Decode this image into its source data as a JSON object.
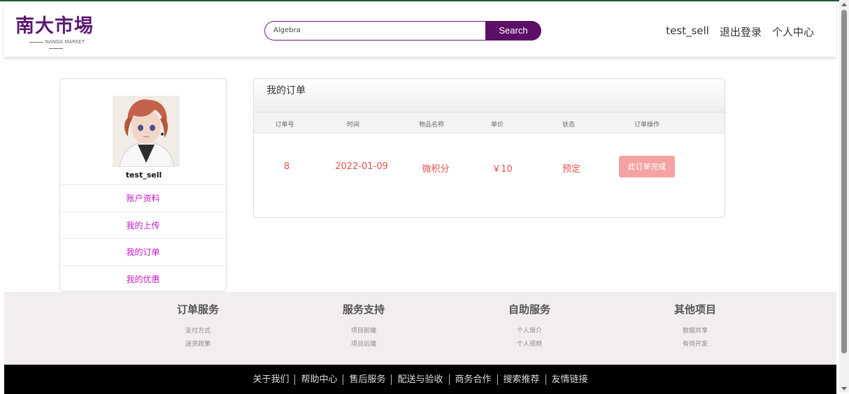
{
  "header": {
    "logo_text": "南大市埸",
    "logo_sub": "NANDA MARKET",
    "search_value": "Algebra",
    "search_button": "Search",
    "nav": [
      "test_sell",
      "退出登录",
      "个人中心"
    ]
  },
  "profile": {
    "username": "test_sell",
    "menu": [
      "账户资料",
      "我的上传",
      "我的订单",
      "我的优惠"
    ]
  },
  "orders": {
    "title": "我的订单",
    "columns": [
      "订单号",
      "时间",
      "物品名称",
      "单价",
      "状态",
      "订单操作"
    ],
    "rows": [
      {
        "id": "8",
        "time": "2022-01-09",
        "item": "微积分",
        "price": "￥10",
        "status": "预定",
        "action": "此订单完成"
      }
    ]
  },
  "services": [
    {
      "title": "订单服务",
      "links": [
        "支付方式",
        "送货政策"
      ]
    },
    {
      "title": "服务支持",
      "links": [
        "项目前端",
        "项目后端"
      ]
    },
    {
      "title": "自助服务",
      "links": [
        "个人简介",
        "个人视频"
      ]
    },
    {
      "title": "其他项目",
      "links": [
        "数据共享",
        "有待开发"
      ]
    }
  ],
  "footer_links": [
    "关于我们",
    "帮助中心",
    "售后服务",
    "配送与验收",
    "商务合作",
    "搜索推荐",
    "友情链接"
  ],
  "colors": {
    "brand": "#5c0f66",
    "menu_link": "#c61bc6",
    "order_text": "#e0524e",
    "finish_button": "#f4a3a2"
  }
}
